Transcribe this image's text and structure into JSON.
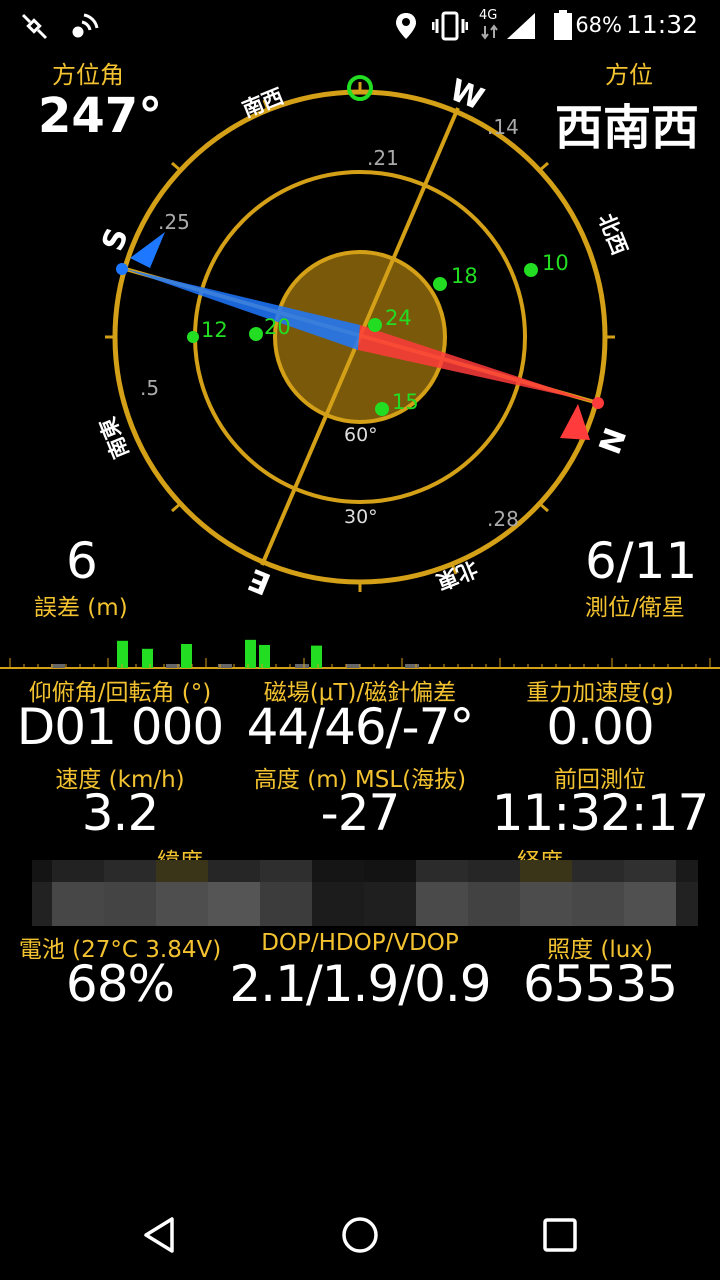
{
  "status_bar": {
    "network": "4G",
    "battery": "68%",
    "time": "11:32"
  },
  "compass": {
    "azimuth_label": "方位角",
    "azimuth_value": "247°",
    "direction_label": "方位",
    "direction_value": "西南西",
    "cardinals": {
      "n": "N",
      "s": "S",
      "e": "E",
      "w": "W"
    },
    "intercardinals": {
      "sw": "南西",
      "nw": "北西",
      "se": "南東",
      "ne": "北東"
    },
    "elevation_rings": [
      "60°",
      "30°"
    ],
    "bearing_markers": [
      ".14",
      ".21",
      ".25",
      ".5",
      ".28"
    ],
    "satellites": [
      "18",
      "10",
      "24",
      "12",
      "20",
      "15"
    ],
    "accuracy_value": "6",
    "accuracy_label": "誤差 (m)",
    "fix_value": "6/11",
    "fix_label": "測位/衛星"
  },
  "signal_bars": [
    0.0,
    0.85,
    0.6,
    0.0,
    0.75,
    0.0,
    0.88,
    0.72,
    0.0,
    0.7,
    0.0,
    0.0
  ],
  "metrics": [
    {
      "label": "仰俯角/回転角 (°)",
      "value": "D01 000"
    },
    {
      "label": "磁場(μT)/磁針偏差",
      "value": "44/46/-7°"
    },
    {
      "label": "重力加速度(g)",
      "value": "0.00"
    },
    {
      "label": "速度 (km/h)",
      "value": "3.2"
    },
    {
      "label": "高度 (m) MSL(海抜)",
      "value": "-27"
    },
    {
      "label": "前回測位",
      "value": "11:32:17"
    }
  ],
  "coords": {
    "lat_label": "緯度",
    "lon_label": "経度"
  },
  "metrics2": [
    {
      "label": "電池 (27°C 3.84V)",
      "value": "68%"
    },
    {
      "label": "DOP/HDOP/VDOP",
      "value": "2.1/1.9/0.9"
    },
    {
      "label": "照度 (lux)",
      "value": "65535"
    }
  ],
  "colors": {
    "accent": "#f2c230",
    "ring": "#d4a017",
    "sat": "#22dd22",
    "north": "#ff3b3b",
    "south": "#1e78ff"
  }
}
